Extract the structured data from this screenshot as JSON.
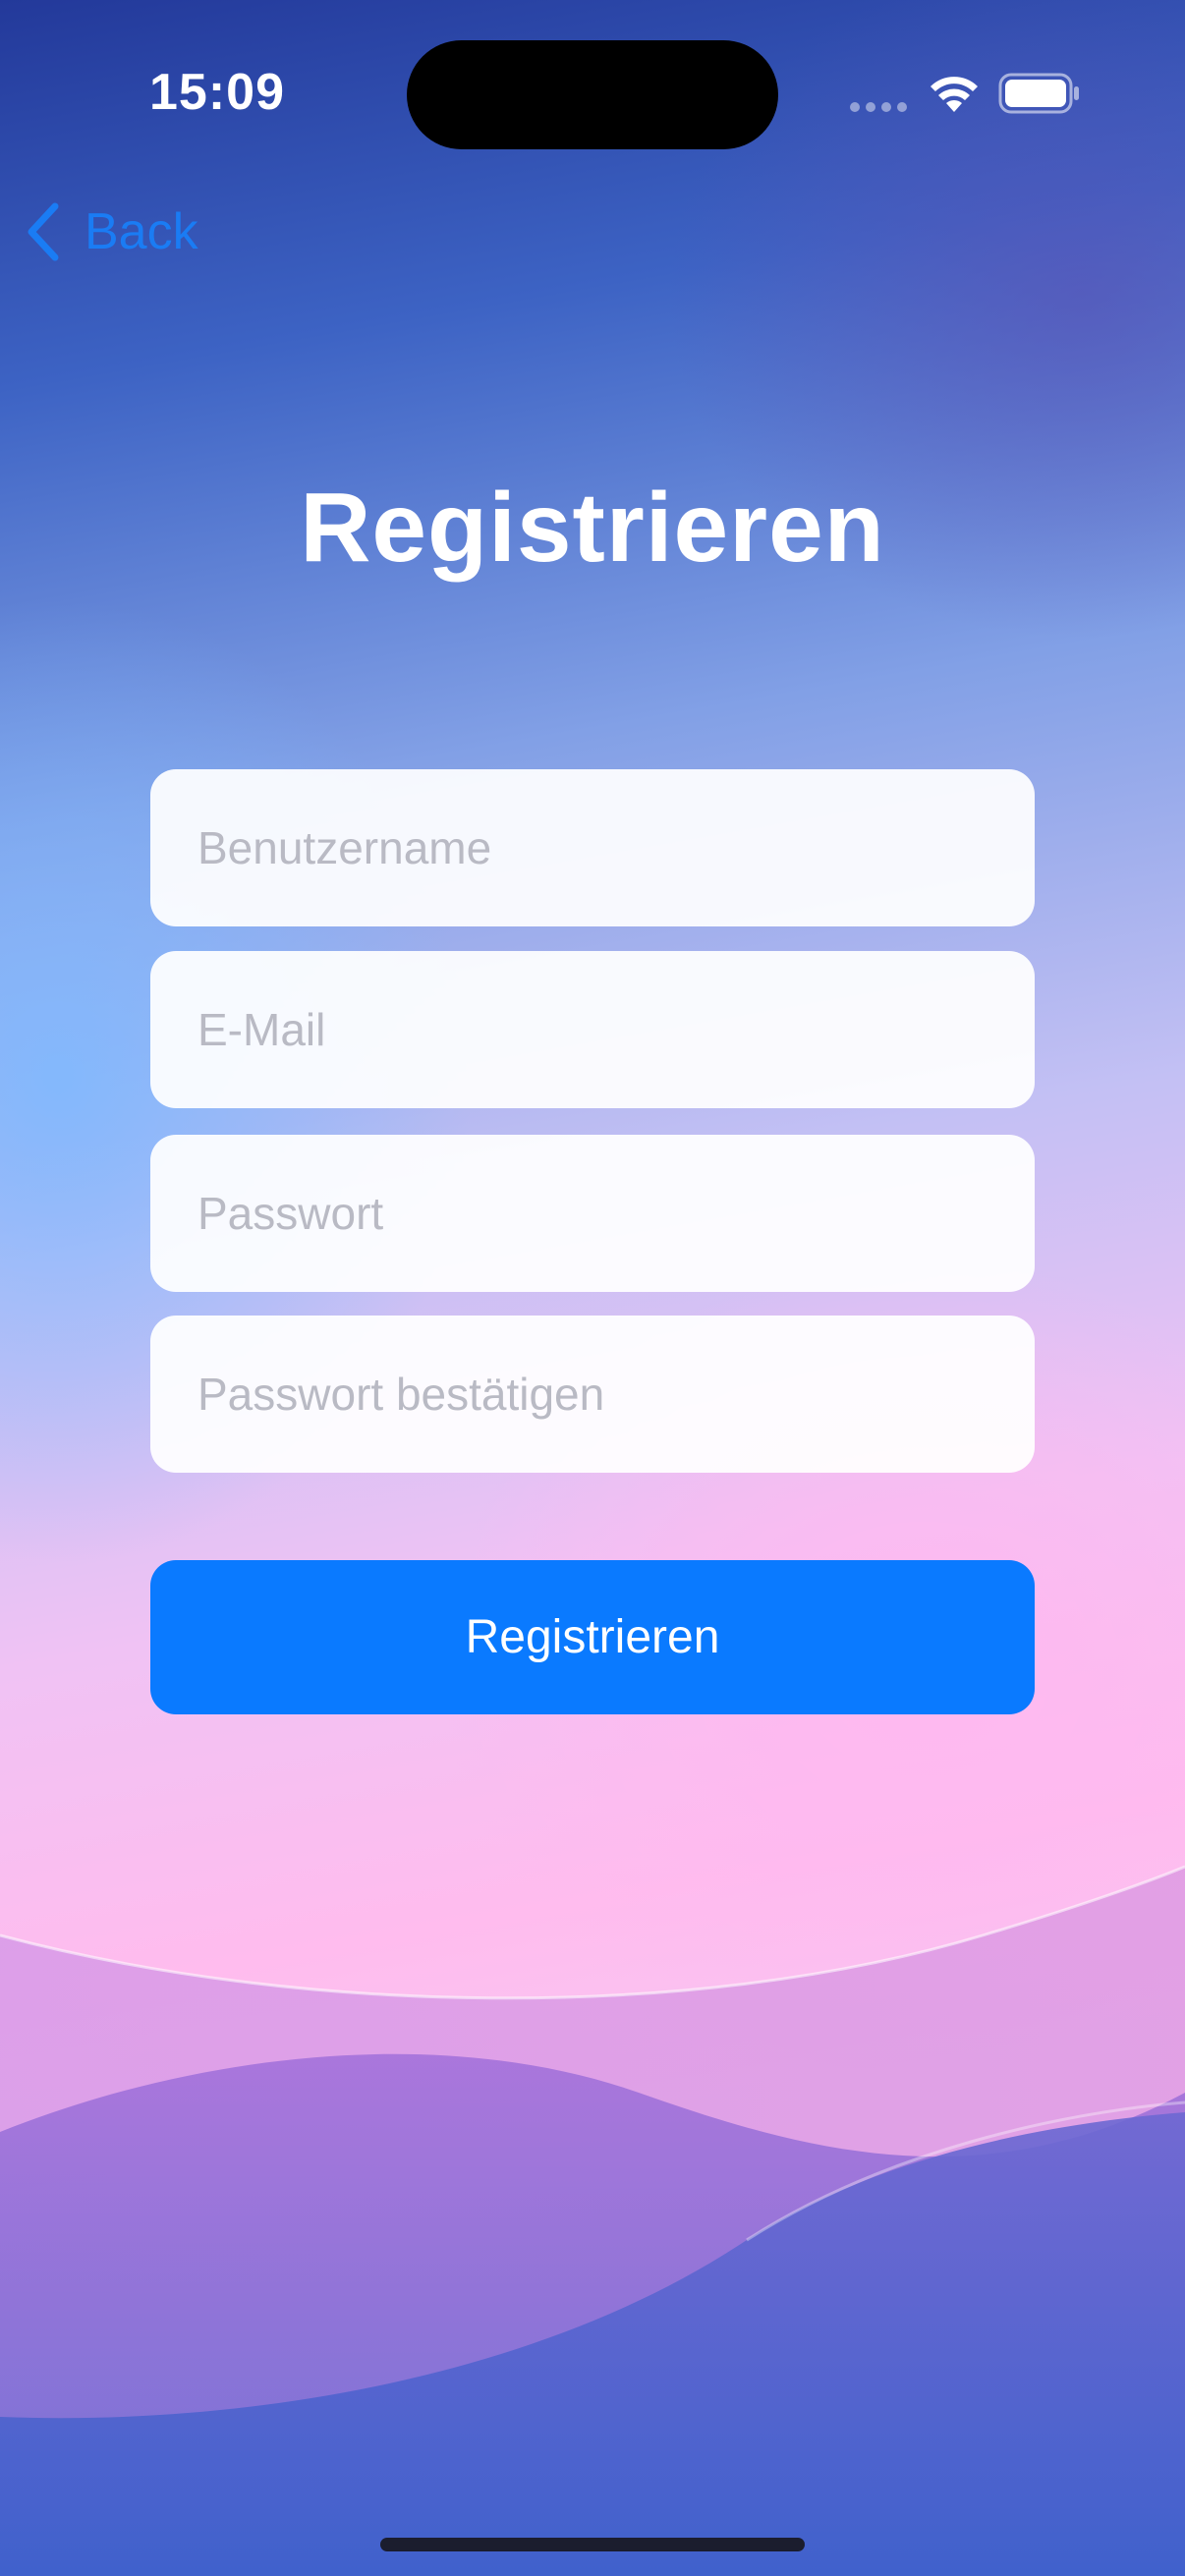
{
  "status_bar": {
    "time": "15:09",
    "icons": [
      "cellular-signal-icon",
      "wifi-icon",
      "battery-icon"
    ]
  },
  "nav": {
    "back_label": "Back",
    "back_icon": "chevron-left-icon"
  },
  "page": {
    "title": "Registrieren"
  },
  "form": {
    "username_placeholder": "Benutzername",
    "email_placeholder": "E-Mail",
    "password_placeholder": "Passwort",
    "confirm_password_placeholder": "Passwort bestätigen",
    "submit_label": "Registrieren"
  },
  "colors": {
    "accent": "#0a7aff",
    "link": "#1a7cf4",
    "title_text": "#ffffff",
    "placeholder": "#b9bac4"
  }
}
